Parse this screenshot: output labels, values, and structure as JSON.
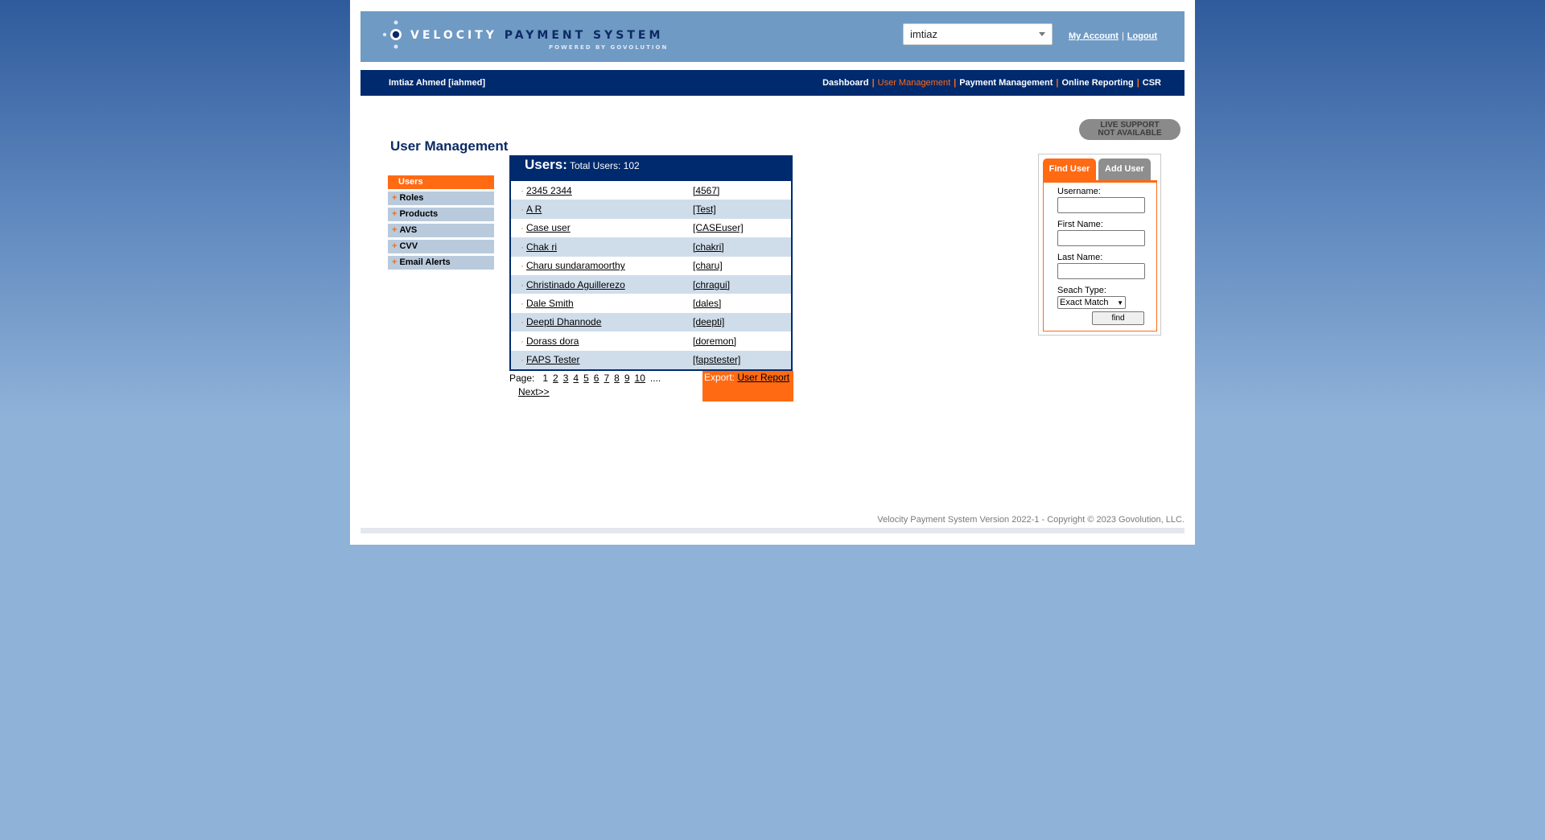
{
  "header": {
    "logo_word1": "VELOCITY",
    "logo_word2": "PAYMENT SYSTEM",
    "logo_sub": "POWERED BY GOVOLUTION",
    "account_value": "imtiaz",
    "my_account": "My Account",
    "logout": "Logout",
    "separator": "|"
  },
  "navbar": {
    "user": "Imtiaz Ahmed [iahmed]",
    "items": [
      "Dashboard",
      "User Management",
      "Payment Management",
      "Online Reporting",
      "CSR"
    ],
    "active_index": 1
  },
  "live_support": {
    "line1": "LIVE SUPPORT",
    "line2": "NOT AVAILABLE"
  },
  "page_title": "User Management",
  "left_menu": {
    "items": [
      "Users",
      "Roles",
      "Products",
      "AVS",
      "CVV",
      "Email Alerts"
    ],
    "active_index": 0,
    "plus": "+"
  },
  "users": {
    "title": "Users:",
    "total": "Total Users: 102",
    "bullet": "·",
    "rows": [
      {
        "name": "2345 2344",
        "id": "[4567]"
      },
      {
        "name": "A R",
        "id": "[Test]"
      },
      {
        "name": "Case user",
        "id": "[CASEuser]"
      },
      {
        "name": "Chak ri",
        "id": "[chakri]"
      },
      {
        "name": "Charu sundaramoorthy",
        "id": "[charu]"
      },
      {
        "name": "Christinado Aguillerezo",
        "id": "[chragui]"
      },
      {
        "name": "Dale Smith",
        "id": "[dales]"
      },
      {
        "name": "Deepti Dhannode",
        "id": "[deepti]"
      },
      {
        "name": "Dorass dora",
        "id": "[doremon]"
      },
      {
        "name": "FAPS Tester",
        "id": "[fapstester]"
      }
    ]
  },
  "pager": {
    "label": "Page:",
    "current": "1",
    "pages": [
      "2",
      "3",
      "4",
      "5",
      "6",
      "7",
      "8",
      "9",
      "10"
    ],
    "ellipsis": "....",
    "next": "Next>>"
  },
  "export": {
    "label": "Export:",
    "link": "User Report"
  },
  "find_user": {
    "tab_find": "Find User",
    "tab_add": "Add User",
    "username_label": "Username:",
    "first_name_label": "First Name:",
    "last_name_label": "Last Name:",
    "search_type_label": "Seach Type:",
    "search_type_value": "Exact Match",
    "find_button": "find"
  },
  "footer": "Velocity Payment System Version 2022-1 - Copyright © 2023 Govolution, LLC.",
  "colors": {
    "navy": "#002a6e",
    "orange": "#ff6a13",
    "header_blue": "#6f9ac4",
    "row_alt": "#cfddeb"
  }
}
